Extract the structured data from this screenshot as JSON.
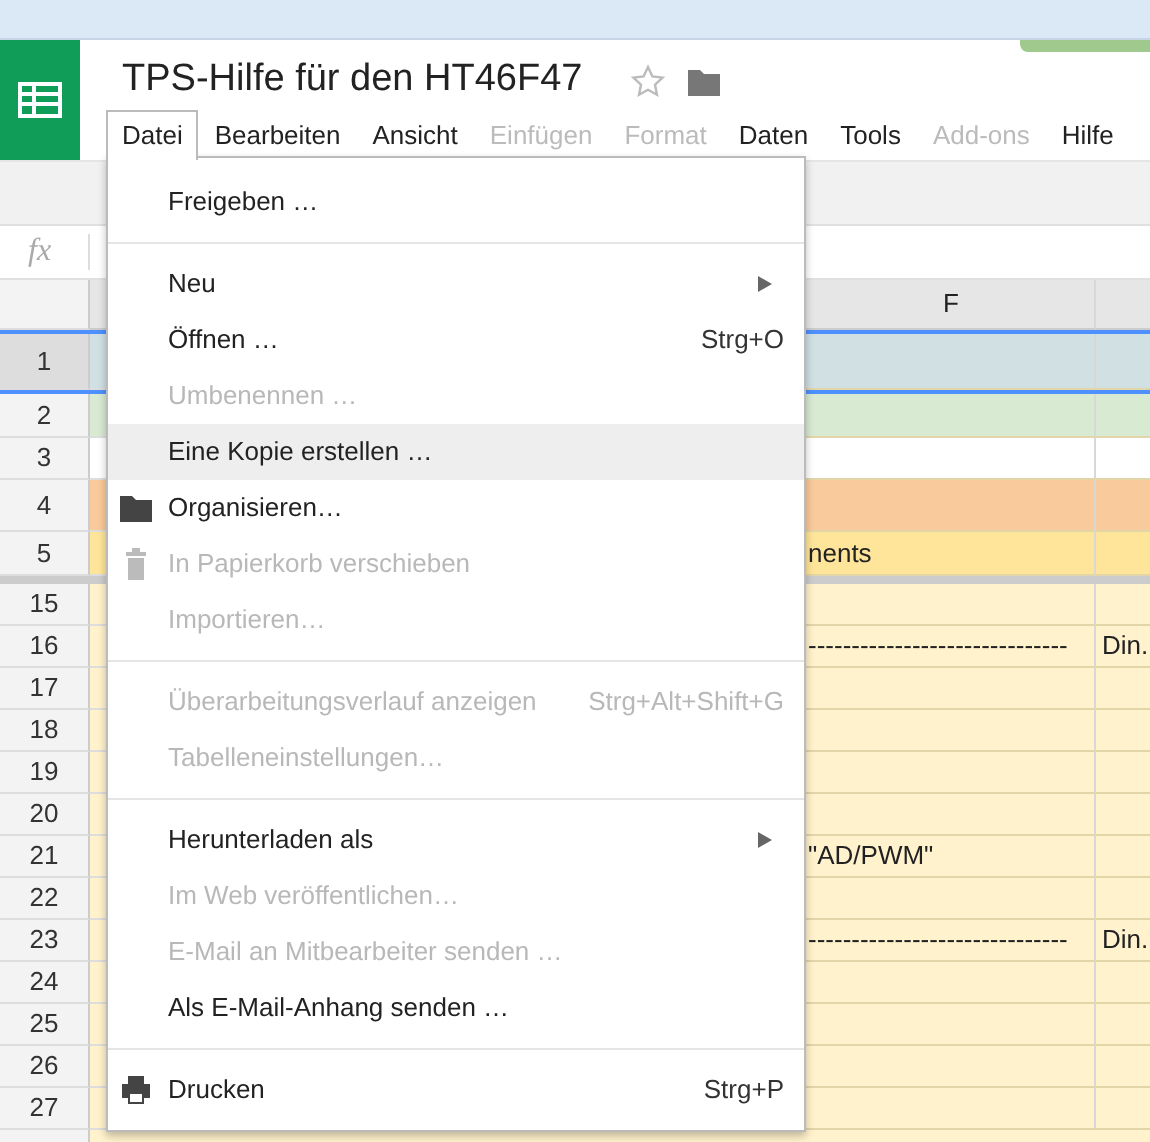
{
  "document": {
    "title": "TPS-Hilfe für den HT46F47"
  },
  "menubar": [
    {
      "label": "Datei",
      "selected": true,
      "disabled": false
    },
    {
      "label": "Bearbeiten",
      "selected": false,
      "disabled": false
    },
    {
      "label": "Ansicht",
      "selected": false,
      "disabled": false
    },
    {
      "label": "Einfügen",
      "selected": false,
      "disabled": true
    },
    {
      "label": "Format",
      "selected": false,
      "disabled": true
    },
    {
      "label": "Daten",
      "selected": false,
      "disabled": false
    },
    {
      "label": "Tools",
      "selected": false,
      "disabled": false
    },
    {
      "label": "Add-ons",
      "selected": false,
      "disabled": true
    },
    {
      "label": "Hilfe",
      "selected": false,
      "disabled": false
    }
  ],
  "formula_bar": {
    "label": "fx"
  },
  "column_headers": [
    {
      "label": "F"
    }
  ],
  "frozen_rows": [
    {
      "number": "1",
      "selected": true,
      "color": "#d0e0e3"
    },
    {
      "number": "2",
      "selected": false,
      "color": "#d9ead3"
    },
    {
      "number": "3",
      "selected": false,
      "color": "#ffffff"
    },
    {
      "number": "4",
      "selected": false,
      "color": "#f9cb9c"
    },
    {
      "number": "5",
      "selected": false,
      "color": "#ffe599",
      "column_f": "nents"
    }
  ],
  "rows": [
    {
      "number": "15",
      "selected": false,
      "color": "#fff2cc"
    },
    {
      "number": "16",
      "selected": false,
      "color": "#fff2cc",
      "column_f": "------------------------------",
      "column_g": "Din."
    },
    {
      "number": "17",
      "selected": false,
      "color": "#fff2cc"
    },
    {
      "number": "18",
      "selected": false,
      "color": "#fff2cc"
    },
    {
      "number": "19",
      "selected": false,
      "color": "#fff2cc"
    },
    {
      "number": "20",
      "selected": false,
      "color": "#fff2cc"
    },
    {
      "number": "21",
      "selected": false,
      "color": "#fff2cc",
      "column_f": "\"AD/PWM\""
    },
    {
      "number": "22",
      "selected": false,
      "color": "#fff2cc"
    },
    {
      "number": "23",
      "selected": false,
      "color": "#fff2cc",
      "column_f": "------------------------------",
      "column_g": "Din."
    },
    {
      "number": "24",
      "selected": false,
      "color": "#fff2cc"
    },
    {
      "number": "25",
      "selected": false,
      "color": "#fff2cc"
    },
    {
      "number": "26",
      "selected": false,
      "color": "#fff2cc"
    },
    {
      "number": "27",
      "selected": false,
      "color": "#fff2cc"
    }
  ],
  "menu": {
    "sections": [
      [
        {
          "label": "Freigeben …",
          "disabled": false,
          "selected": false
        }
      ],
      [
        {
          "label": "Neu",
          "disabled": false,
          "selected": false,
          "submenu": true
        },
        {
          "label": "Öffnen …",
          "disabled": false,
          "selected": false,
          "shortcut": "Strg+O"
        },
        {
          "label": "Umbenennen …",
          "disabled": true,
          "selected": false
        },
        {
          "label": "Eine Kopie erstellen …",
          "disabled": false,
          "selected": true
        },
        {
          "label": "Organisieren…",
          "disabled": false,
          "selected": false,
          "kind": "icon"
        },
        {
          "label": "In Papierkorb verschieben",
          "disabled": true,
          "selected": false,
          "kind": "icon"
        },
        {
          "label": "Importieren…",
          "disabled": true,
          "selected": false
        }
      ],
      [
        {
          "label": "Überarbeitungsverlauf anzeigen",
          "disabled": true,
          "selected": false,
          "shortcut": "Strg+Alt+Shift+G"
        },
        {
          "label": "Tabelleneinstellungen…",
          "disabled": true,
          "selected": false
        }
      ],
      [
        {
          "label": "Herunterladen als",
          "disabled": false,
          "selected": false,
          "submenu": true
        },
        {
          "label": "Im Web veröffentlichen…",
          "disabled": true,
          "selected": false
        },
        {
          "label": "E-Mail an Mitbearbeiter senden …",
          "disabled": true,
          "selected": false
        },
        {
          "label": "Als E-Mail-Anhang senden …",
          "disabled": false,
          "selected": false
        }
      ],
      [
        {
          "label": "Drucken",
          "disabled": false,
          "selected": false,
          "kind": "icon",
          "shortcut": "Strg+P"
        }
      ]
    ]
  }
}
